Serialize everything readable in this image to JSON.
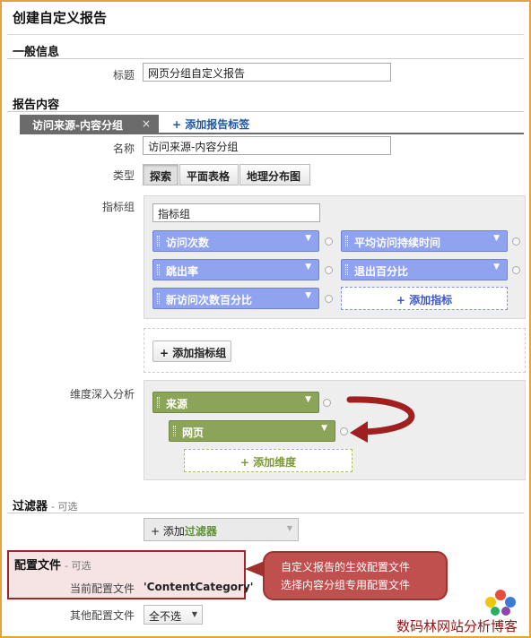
{
  "page_title": "创建自定义报告",
  "general": {
    "heading": "一般信息",
    "title_label": "标题",
    "title_value": "网页分组自定义报告"
  },
  "report_content": {
    "heading": "报告内容",
    "active_tab": "访问来源-内容分组",
    "close_symbol": "×",
    "add_tab_label": "+ 添加报告标签",
    "name_label": "名称",
    "name_value": "访问来源-内容分组",
    "type_label": "类型",
    "type_options": [
      "探索",
      "平面表格",
      "地理分布图"
    ],
    "selected_type": "探索",
    "metric_group_label": "指标组",
    "metric_group_name": "指标组",
    "metrics": [
      "访问次数",
      "平均访问持续时间",
      "跳出率",
      "退出百分比",
      "新访问次数百分比"
    ],
    "add_metric_label": "+ 添加指标",
    "add_metric_group_label": "+ 添加指标组",
    "dimension_label": "维度深入分析",
    "dimensions": [
      "来源",
      "网页"
    ],
    "add_dimension_label": "+ 添加维度"
  },
  "filters": {
    "heading": "过滤器",
    "optional": "- 可选",
    "add_prefix": "+ 添加",
    "add_highlight": "过滤器"
  },
  "profile": {
    "heading": "配置文件",
    "optional": "- 可选",
    "current_label": "当前配置文件",
    "current_value": "'ContentCategory'",
    "other_label": "其他配置文件",
    "other_value": "全不选"
  },
  "callout": {
    "line1": "自定义报告的生效配置文件",
    "line2": "选择内容分组专用配置文件"
  },
  "watermark": "数码林网站分析博客",
  "colors": {
    "frame": "#e5a43a",
    "metric_pill": "#8fa3ef",
    "dimension_pill": "#8ca35a",
    "highlight_box": "#a32424",
    "callout": "#c0504d"
  }
}
